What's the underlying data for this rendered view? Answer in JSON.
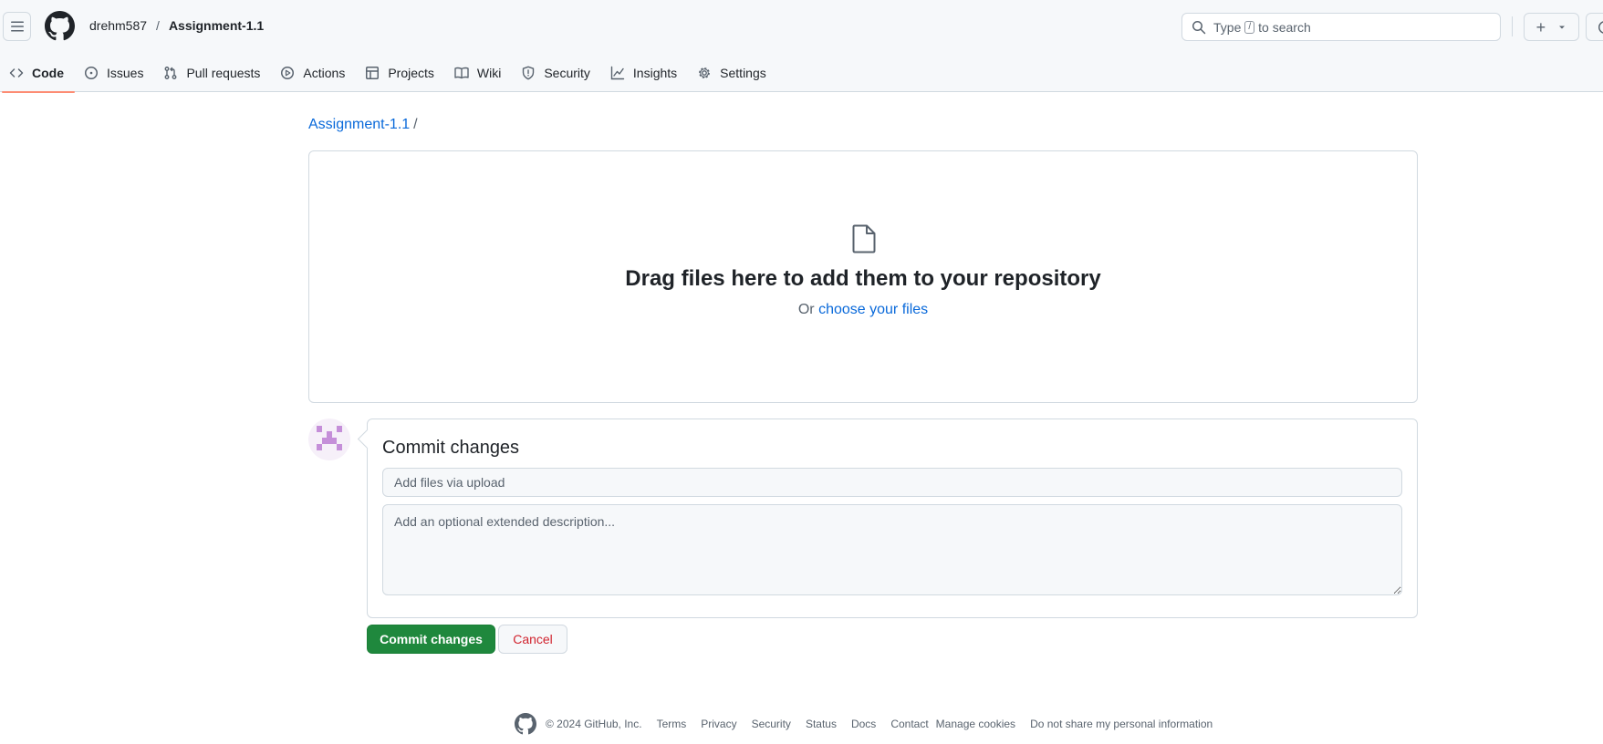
{
  "header": {
    "owner": "drehm587",
    "separator": "/",
    "repo": "Assignment-1.1",
    "search": {
      "prefix": "Type",
      "key": "/",
      "suffix": "to search"
    },
    "plus_label": "+"
  },
  "tabs": [
    {
      "label": "Code",
      "icon": "code-icon",
      "active": true
    },
    {
      "label": "Issues",
      "icon": "issue-opened-icon"
    },
    {
      "label": "Pull requests",
      "icon": "git-pull-request-icon"
    },
    {
      "label": "Actions",
      "icon": "play-icon"
    },
    {
      "label": "Projects",
      "icon": "table-icon"
    },
    {
      "label": "Wiki",
      "icon": "book-icon"
    },
    {
      "label": "Security",
      "icon": "shield-icon"
    },
    {
      "label": "Insights",
      "icon": "graph-icon"
    },
    {
      "label": "Settings",
      "icon": "gear-icon"
    }
  ],
  "main": {
    "repo_crumb": "Assignment-1.1",
    "crumb_slash": "/",
    "dropzone": {
      "title": "Drag files here to add them to your repository",
      "or_text": "Or",
      "choose_link": "choose your files"
    },
    "commit": {
      "title": "Commit changes",
      "summary_placeholder": "Add files via upload",
      "description_placeholder": "Add an optional extended description...",
      "commit_button": "Commit changes",
      "cancel_button": "Cancel"
    }
  },
  "footer": {
    "copyright": "© 2024 GitHub, Inc.",
    "links": [
      "Terms",
      "Privacy",
      "Security",
      "Status",
      "Docs",
      "Contact",
      "Manage cookies",
      "Do not share my personal information"
    ]
  },
  "colors": {
    "accent_link": "#0969da",
    "tab_underline": "#fd8c73",
    "primary_button": "#1f883d",
    "danger_text": "#d1242f",
    "avatar_purple": "#c58fd9"
  }
}
